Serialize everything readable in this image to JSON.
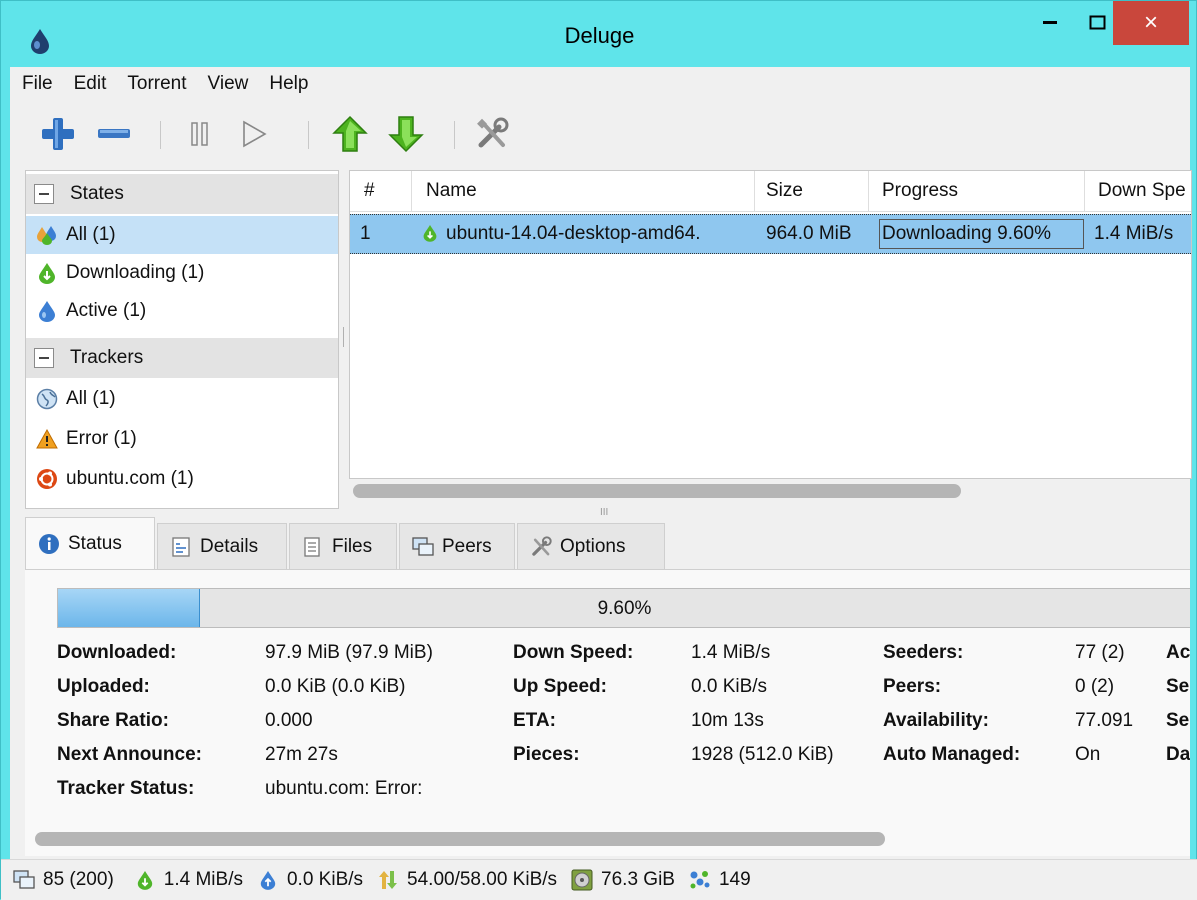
{
  "window": {
    "title": "Deluge",
    "minimize": "–",
    "maximize": "□",
    "close": "×"
  },
  "menu": [
    "File",
    "Edit",
    "Torrent",
    "View",
    "Help"
  ],
  "toolbar": {
    "icons": [
      "add-icon",
      "remove-icon",
      "pause-icon",
      "resume-icon",
      "queue-up-icon",
      "queue-down-icon",
      "preferences-icon"
    ]
  },
  "sidebar": {
    "states_label": "States",
    "states": [
      {
        "label": "All (1)",
        "icon": "all-states-icon",
        "selected": true
      },
      {
        "label": "Downloading (1)",
        "icon": "downloading-icon"
      },
      {
        "label": "Active (1)",
        "icon": "active-icon"
      }
    ],
    "trackers_label": "Trackers",
    "trackers": [
      {
        "label": "All (1)",
        "icon": "globe-icon"
      },
      {
        "label": "Error (1)",
        "icon": "warning-icon"
      },
      {
        "label": "ubuntu.com (1)",
        "icon": "ubuntu-icon"
      }
    ]
  },
  "torrent_list": {
    "columns": [
      "#",
      "Name",
      "Size",
      "Progress",
      "Down Spe"
    ],
    "rows": [
      {
        "num": "1",
        "name": "ubuntu-14.04-desktop-amd64.",
        "size": "964.0 MiB",
        "progress": "Downloading 9.60%",
        "down_speed": "1.4 MiB/s"
      }
    ]
  },
  "tabs": [
    {
      "label": "Status",
      "icon": "info-icon",
      "active": true
    },
    {
      "label": "Details",
      "icon": "details-icon"
    },
    {
      "label": "Files",
      "icon": "files-icon"
    },
    {
      "label": "Peers",
      "icon": "peers-icon"
    },
    {
      "label": "Options",
      "icon": "options-icon"
    }
  ],
  "status": {
    "progress_fraction": 0.096,
    "progress_text": "9.60%",
    "col1": [
      {
        "k": "Downloaded:",
        "v": "97.9 MiB (97.9 MiB)"
      },
      {
        "k": "Uploaded:",
        "v": "0.0 KiB (0.0 KiB)"
      },
      {
        "k": "Share Ratio:",
        "v": "0.000"
      },
      {
        "k": "Next Announce:",
        "v": "27m 27s"
      },
      {
        "k": "Tracker Status:",
        "v": "ubuntu.com: Error:"
      }
    ],
    "col2": [
      {
        "k": "Down Speed:",
        "v": "1.4 MiB/s"
      },
      {
        "k": "Up Speed:",
        "v": "0.0 KiB/s"
      },
      {
        "k": "ETA:",
        "v": "10m 13s"
      },
      {
        "k": "Pieces:",
        "v": "1928 (512.0 KiB)"
      }
    ],
    "col3": [
      {
        "k": "Seeders:",
        "v": "77 (2)",
        "cut": "Ac"
      },
      {
        "k": "Peers:",
        "v": "0 (2)",
        "cut": "Se"
      },
      {
        "k": "Availability:",
        "v": "77.091",
        "cut": "Se"
      },
      {
        "k": "Auto Managed:",
        "v": "On",
        "cut": "Da"
      }
    ]
  },
  "statusbar": {
    "connections": "85 (200)",
    "down_speed": "1.4 MiB/s",
    "up_speed": "0.0 KiB/s",
    "protocol": "54.00/58.00 KiB/s",
    "free_space": "76.3 GiB",
    "dht": "149"
  }
}
